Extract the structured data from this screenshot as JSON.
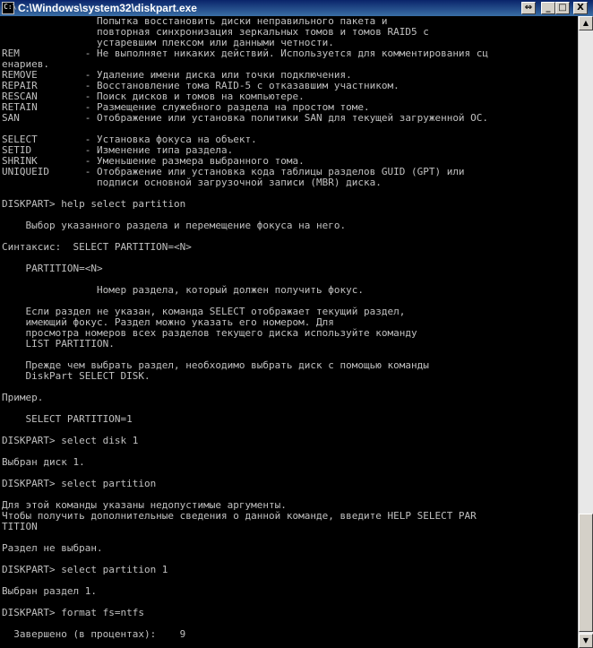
{
  "window": {
    "title": "C:\\Windows\\system32\\diskpart.exe",
    "icon_text": "C:\\",
    "buttons": {
      "extra": "⇔",
      "minimize": "_",
      "maximize": "□",
      "close": "X"
    }
  },
  "scrollbar": {
    "up_arrow": "▲",
    "down_arrow": "▼"
  },
  "console": {
    "lines": [
      "                Попытка восстановить диски неправильного пакета и",
      "                повторная синхронизация зеркальных томов и томов RAID5 с",
      "                устаревшим плексом или данными четности.",
      "REM           - Не выполняет никаких действий. Используется для комментирования сц",
      "енариев.",
      "REMOVE        - Удаление имени диска или точки подключения.",
      "REPAIR        - Восстановление тома RAID-5 с отказавшим участником.",
      "RESCAN        - Поиск дисков и томов на компьютере.",
      "RETAIN        - Размещение служебного раздела на простом томе.",
      "SAN           - Отображение или установка политики SAN для текущей загруженной ОС.",
      "",
      "SELECT        - Установка фокуса на объект.",
      "SETID         - Изменение типа раздела.",
      "SHRINK        - Уменьшение размера выбранного тома.",
      "UNIQUEID      - Отображение или установка кода таблицы разделов GUID (GPT) или",
      "                подписи основной загрузочной записи (MBR) диска.",
      "",
      "DISKPART> help select partition",
      "",
      "    Выбор указанного раздела и перемещение фокуса на него.",
      "",
      "Синтаксис:  SELECT PARTITION=<N>",
      "",
      "    PARTITION=<N>",
      "",
      "                Номер раздела, который должен получить фокус.",
      "",
      "    Если раздел не указан, команда SELECT отображает текущий раздел,",
      "    имеющий фокус. Раздел можно указать его номером. Для",
      "    просмотра номеров всех разделов текущего диска используйте команду",
      "    LIST PARTITION.",
      "",
      "    Прежде чем выбрать раздел, необходимо выбрать диск с помощью команды",
      "    DiskPart SELECT DISK.",
      "",
      "Пример.",
      "",
      "    SELECT PARTITION=1",
      "",
      "DISKPART> select disk 1",
      "",
      "Выбран диск 1.",
      "",
      "DISKPART> select partition",
      "",
      "Для этой команды указаны недопустимые аргументы.",
      "Чтобы получить дополнительные сведения о данной команде, введите HELP SELECT PAR",
      "TITION",
      "",
      "Раздел не выбран.",
      "",
      "DISKPART> select partition 1",
      "",
      "Выбран раздел 1.",
      "",
      "DISKPART> format fs=ntfs",
      "",
      "  Завершено (в процентах):    9"
    ]
  }
}
